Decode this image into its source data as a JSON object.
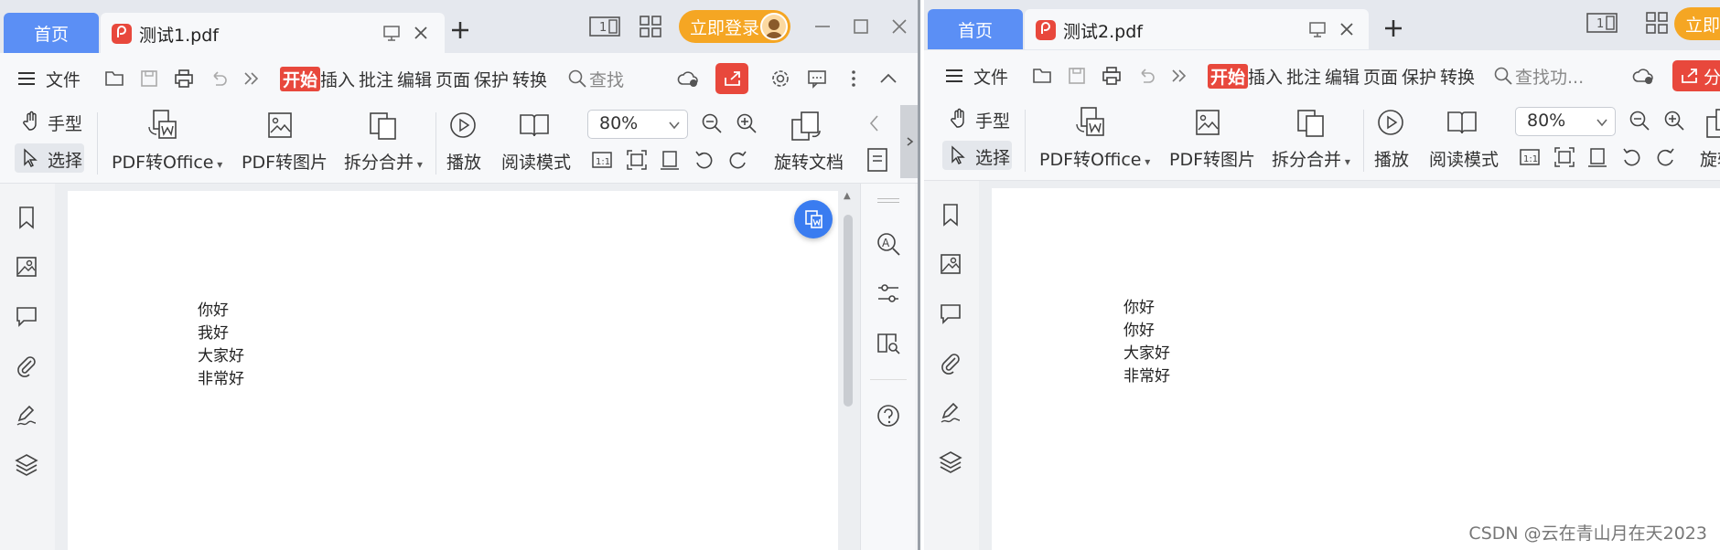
{
  "colors": {
    "accent_blue": "#5b8ff5",
    "pdf_red": "#e8483c",
    "login_orange": "#f5a623"
  },
  "icons": [
    "file-icon",
    "open-icon",
    "save-icon",
    "print-icon",
    "undo-icon",
    "more-icon",
    "search-icon",
    "cloud-icon",
    "share-icon",
    "settings-icon",
    "comment-icon",
    "kebab-icon",
    "collapse-icon",
    "hand-icon",
    "cursor-icon",
    "pdf-to-office-icon",
    "pdf-to-image-icon",
    "split-merge-icon",
    "play-icon",
    "reading-mode-icon",
    "zoom-out-icon",
    "zoom-in-icon",
    "actual-size-icon",
    "fit-page-icon",
    "fit-width-icon",
    "rotate-left-icon",
    "rotate-right-icon",
    "rotate-document-icon",
    "bookmark-icon",
    "image-icon",
    "comment-bubble-icon",
    "attachment-icon",
    "signature-icon",
    "layers-icon",
    "text-search-icon",
    "adjust-icon",
    "read-doc-icon",
    "help-icon"
  ],
  "window1": {
    "home_tab": "首页",
    "doc_tab": "测试1.pdf",
    "login_label": "立即登录",
    "menu": {
      "file": "文件",
      "start": "开始",
      "insert": "插入",
      "annotate": "批注",
      "edit": "编辑",
      "page": "页面",
      "protect": "保护",
      "convert": "转换",
      "search_placeholder": "查找"
    },
    "ribbon": {
      "hand": "手型",
      "select": "选择",
      "pdf_office": "PDF转Office",
      "pdf_image": "PDF转图片",
      "split_merge": "拆分合并",
      "play": "播放",
      "read_mode": "阅读模式",
      "zoom": "80%",
      "rotate_doc": "旋转文档"
    },
    "page_lines": [
      "你好",
      "我好",
      "大家好",
      "非常好"
    ]
  },
  "window2": {
    "home_tab": "首页",
    "doc_tab": "测试2.pdf",
    "login_label": "立即登",
    "menu": {
      "file": "文件",
      "start": "开始",
      "insert": "插入",
      "annotate": "批注",
      "edit": "编辑",
      "page": "页面",
      "protect": "保护",
      "convert": "转换",
      "search_placeholder": "查找功...",
      "share": "分"
    },
    "ribbon": {
      "hand": "手型",
      "select": "选择",
      "pdf_office": "PDF转Office",
      "pdf_image": "PDF转图片",
      "split_merge": "拆分合并",
      "play": "播放",
      "read_mode": "阅读模式",
      "zoom": "80%",
      "rotate_doc": "旋转"
    },
    "page_lines": [
      "你好",
      "你好",
      "大家好",
      "非常好"
    ]
  },
  "watermark": "CSDN @云在青山月在天2023"
}
